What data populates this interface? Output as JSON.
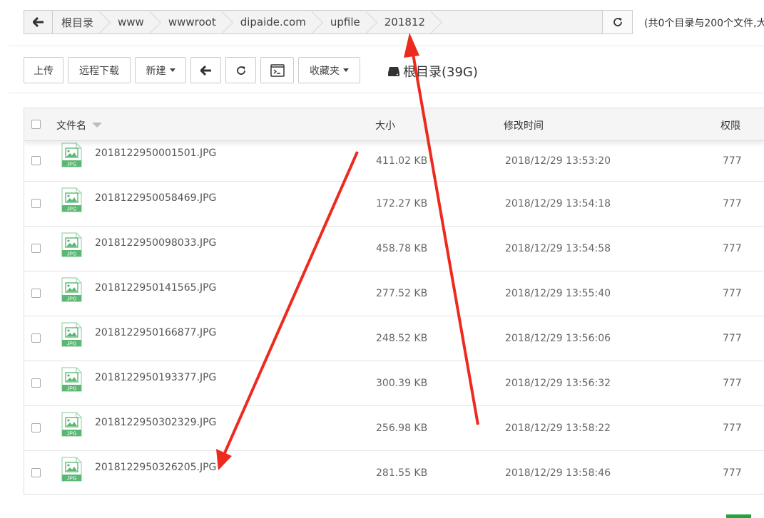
{
  "breadcrumb": {
    "items": [
      "根目录",
      "www",
      "wwwroot",
      "dipaide.com",
      "upfile",
      "201812"
    ]
  },
  "summary": "(共0个目录与200个文件,大",
  "toolbar": {
    "upload": "上传",
    "remote_download": "远程下载",
    "new": "新建",
    "favorites": "收藏夹",
    "disk_label": "根目录(39G)"
  },
  "table": {
    "headers": {
      "name": "文件名",
      "size": "大小",
      "mtime": "修改时间",
      "perm": "权限"
    },
    "file_icon_label": "JPG",
    "rows": [
      {
        "name": "2018122950001501.JPG",
        "size": "411.02 KB",
        "mtime": "2018/12/29 13:53:20",
        "perm": "777"
      },
      {
        "name": "2018122950058469.JPG",
        "size": "172.27 KB",
        "mtime": "2018/12/29 13:54:18",
        "perm": "777"
      },
      {
        "name": "2018122950098033.JPG",
        "size": "458.78 KB",
        "mtime": "2018/12/29 13:54:58",
        "perm": "777"
      },
      {
        "name": "2018122950141565.JPG",
        "size": "277.52 KB",
        "mtime": "2018/12/29 13:55:40",
        "perm": "777"
      },
      {
        "name": "2018122950166877.JPG",
        "size": "248.52 KB",
        "mtime": "2018/12/29 13:56:06",
        "perm": "777"
      },
      {
        "name": "2018122950193377.JPG",
        "size": "300.39 KB",
        "mtime": "2018/12/29 13:56:32",
        "perm": "777"
      },
      {
        "name": "2018122950302329.JPG",
        "size": "256.98 KB",
        "mtime": "2018/12/29 13:58:22",
        "perm": "777"
      },
      {
        "name": "2018122950326205.JPG",
        "size": "281.55 KB",
        "mtime": "2018/12/29 13:58:46",
        "perm": "777"
      }
    ]
  },
  "colors": {
    "accent": "#20a53a",
    "annotation": "#ee2a1f",
    "file_icon": "#5ab873"
  }
}
